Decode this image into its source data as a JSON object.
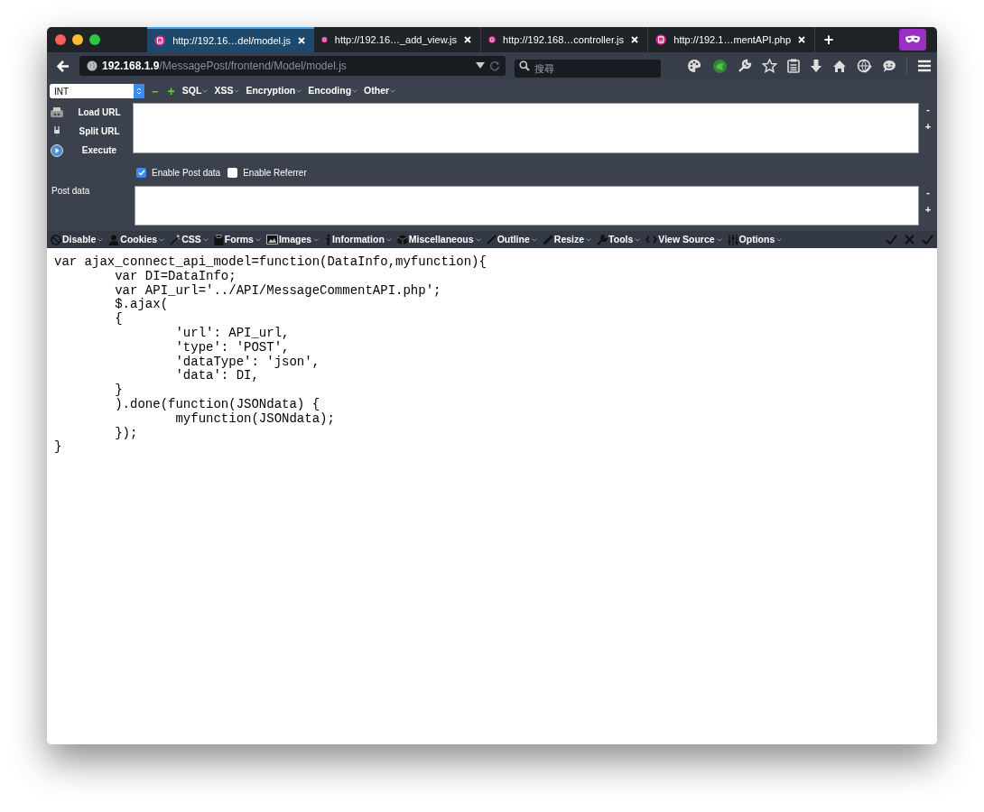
{
  "tabs": [
    {
      "title": "http://192.16…del/model.js",
      "selected": true
    },
    {
      "title": "http://192.16…_add_view.js",
      "selected": false
    },
    {
      "title": "http://192.168…controller.js",
      "selected": false
    },
    {
      "title": "http://192.1…mentAPI.php",
      "selected": false
    }
  ],
  "new_tab": "+",
  "address": {
    "host": "192.168.1.9",
    "path": "/MessagePost/frontend/Model/model.js"
  },
  "search": {
    "placeholder": "搜尋"
  },
  "hackbar": {
    "type_select": "INT",
    "minus": "−",
    "plus": "+",
    "menus": [
      "SQL",
      "XSS",
      "Encryption",
      "Encoding",
      "Other"
    ],
    "actions": [
      {
        "label": "Load URL",
        "kind": "load"
      },
      {
        "label": "Split URL",
        "kind": "split"
      },
      {
        "label": "Execute",
        "kind": "execute"
      }
    ],
    "options": [
      {
        "label": "Enable Post data",
        "checked": true
      },
      {
        "label": "Enable Referrer",
        "checked": false
      }
    ],
    "post_data_label": "Post data",
    "url_resize": [
      "-",
      "+"
    ],
    "post_resize": [
      "-",
      "+"
    ]
  },
  "toolbar": [
    {
      "label": "Disable",
      "kind": "disable"
    },
    {
      "label": "Cookies",
      "kind": "cookies"
    },
    {
      "label": "CSS",
      "kind": "css"
    },
    {
      "label": "Forms",
      "kind": "forms"
    },
    {
      "label": "Images",
      "kind": "images"
    },
    {
      "label": "Information",
      "kind": "information"
    },
    {
      "label": "Miscellaneous",
      "kind": "misc"
    },
    {
      "label": "Outline",
      "kind": "outline"
    },
    {
      "label": "Resize",
      "kind": "resize"
    },
    {
      "label": "Tools",
      "kind": "tools"
    },
    {
      "label": "View Source",
      "kind": "source"
    },
    {
      "label": "Options",
      "kind": "options"
    }
  ],
  "code": [
    "var ajax_connect_api_model=function(DataInfo,myfunction){",
    "\tvar DI=DataInfo;",
    "\tvar API_url='../API/MessageCommentAPI.php';",
    "\t$.ajax(",
    "\t{",
    "\t\t'url': API_url,",
    "\t\t'type': 'POST',",
    "\t\t'dataType': 'json',",
    "\t\t'data': DI,",
    "\t}",
    "\t).done(function(JSONdata) {",
    "\t\tmyfunction(JSONdata);",
    "\t});",
    "}"
  ]
}
